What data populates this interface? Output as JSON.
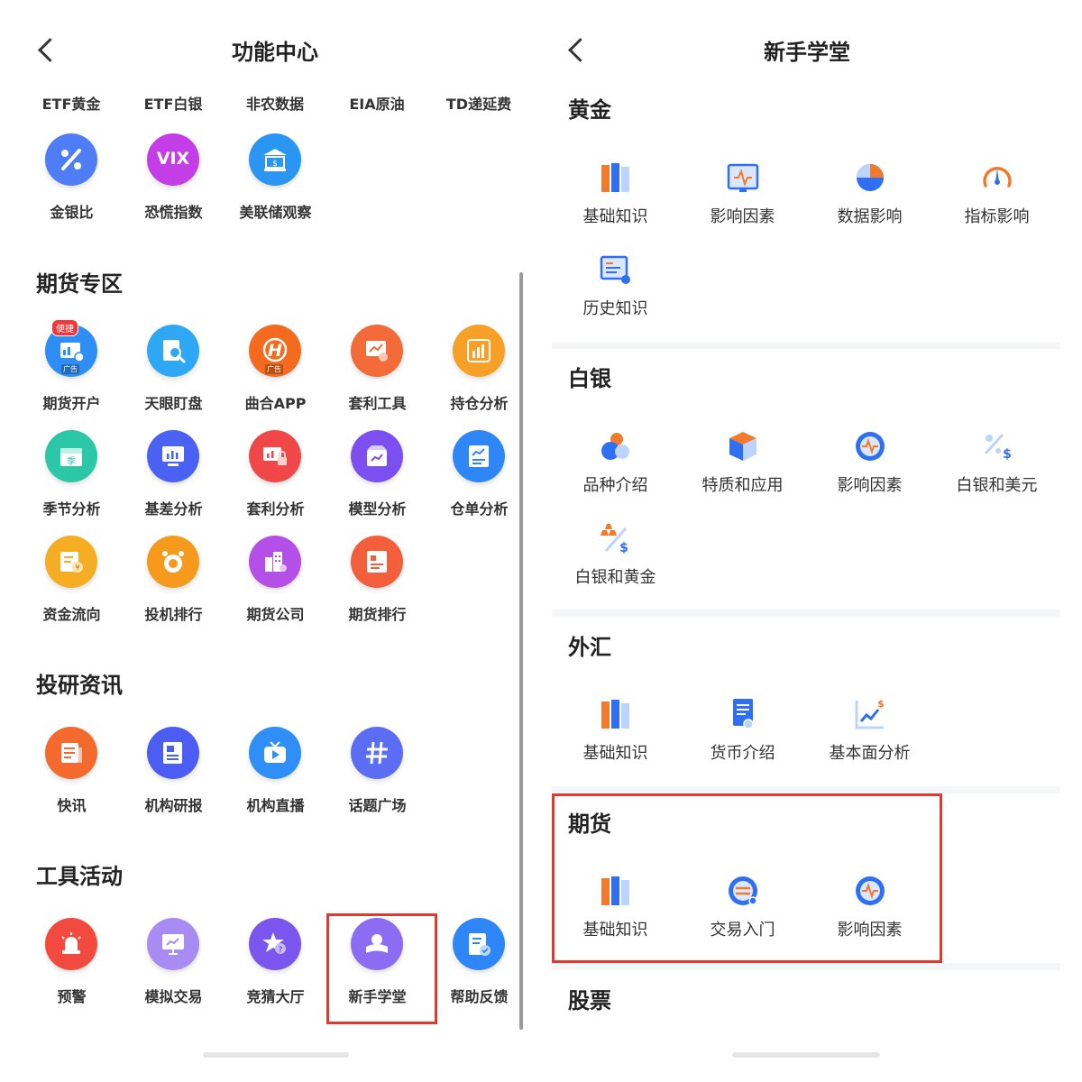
{
  "left": {
    "title": "功能中心",
    "top_tabs": [
      "ETF黄金",
      "ETF白银",
      "非农数据",
      "EIA原油",
      "TD递延费"
    ],
    "top_items": [
      {
        "label": "金银比",
        "icon": "percent-icon",
        "color": "#4f7df6"
      },
      {
        "label": "恐慌指数",
        "icon": "vix-icon",
        "text": "VIX",
        "color": "#c43ee8"
      },
      {
        "label": "美联储观察",
        "icon": "bank-icon",
        "color": "#2b95f4"
      }
    ],
    "sections": [
      {
        "title": "期货专区",
        "items": [
          {
            "label": "期货开户",
            "icon": "account-open-icon",
            "color": "#2e8ef6",
            "badge": "便捷",
            "ad": "广告"
          },
          {
            "label": "天眼盯盘",
            "icon": "search-doc-icon",
            "color": "#2ea8f5"
          },
          {
            "label": "曲合APP",
            "icon": "app-logo-icon",
            "color": "#f46b1f",
            "ad": "广告"
          },
          {
            "label": "套利工具",
            "icon": "arbitrage-tool-icon",
            "color": "#f26b38"
          },
          {
            "label": "持仓分析",
            "icon": "position-chart-icon",
            "color": "#f7a028"
          },
          {
            "label": "季节分析",
            "icon": "calendar-icon",
            "color": "#2cc7a6"
          },
          {
            "label": "基差分析",
            "icon": "monitor-chart-icon",
            "color": "#4a62f3"
          },
          {
            "label": "套利分析",
            "icon": "lock-chart-icon",
            "color": "#f04848"
          },
          {
            "label": "模型分析",
            "icon": "box-chart-icon",
            "color": "#7b4ff0"
          },
          {
            "label": "仓单分析",
            "icon": "warehouse-doc-icon",
            "color": "#2f86f6"
          },
          {
            "label": "资金流向",
            "icon": "money-flow-icon",
            "color": "#f5ad23"
          },
          {
            "label": "投机排行",
            "icon": "alarm-clock-icon",
            "color": "#f59a1d"
          },
          {
            "label": "期货公司",
            "icon": "building-icon",
            "color": "#b44fe8"
          },
          {
            "label": "期货排行",
            "icon": "ranking-list-icon",
            "color": "#f35e3b"
          }
        ]
      },
      {
        "title": "投研资讯",
        "items": [
          {
            "label": "快讯",
            "icon": "news-flash-icon",
            "color": "#f46a2e"
          },
          {
            "label": "机构研报",
            "icon": "report-icon",
            "color": "#4b5df2"
          },
          {
            "label": "机构直播",
            "icon": "tv-play-icon",
            "color": "#2f8ff6"
          },
          {
            "label": "话题广场",
            "icon": "hashtag-icon",
            "color": "#5b6ef3"
          }
        ]
      },
      {
        "title": "工具活动",
        "items": [
          {
            "label": "预警",
            "icon": "siren-icon",
            "color": "#f24a3e"
          },
          {
            "label": "模拟交易",
            "icon": "presentation-icon",
            "color": "#a98cf3"
          },
          {
            "label": "竞猜大厅",
            "icon": "star-question-icon",
            "color": "#7a55ee"
          },
          {
            "label": "新手学堂",
            "icon": "graduation-icon",
            "color": "#8c6cf2"
          },
          {
            "label": "帮助反馈",
            "icon": "feedback-doc-icon",
            "color": "#2f86f6"
          }
        ]
      }
    ]
  },
  "right": {
    "title": "新手学堂",
    "sections": [
      {
        "title": "黄金",
        "items": [
          {
            "label": "基础知识",
            "icon": "books-icon"
          },
          {
            "label": "影响因素",
            "icon": "pulse-book-icon"
          },
          {
            "label": "数据影响",
            "icon": "pie-icon"
          },
          {
            "label": "指标影响",
            "icon": "gauge-icon"
          },
          {
            "label": "历史知识",
            "icon": "history-doc-icon"
          }
        ]
      },
      {
        "title": "白银",
        "items": [
          {
            "label": "品种介绍",
            "icon": "bubbles-icon"
          },
          {
            "label": "特质和应用",
            "icon": "cube-icon"
          },
          {
            "label": "影响因素",
            "icon": "pulse-circle-icon"
          },
          {
            "label": "白银和美元",
            "icon": "silver-dollar-icon"
          },
          {
            "label": "白银和黄金",
            "icon": "silver-gold-icon"
          }
        ]
      },
      {
        "title": "外汇",
        "items": [
          {
            "label": "基础知识",
            "icon": "books-icon"
          },
          {
            "label": "货币介绍",
            "icon": "currency-doc-icon"
          },
          {
            "label": "基本面分析",
            "icon": "trend-dollar-icon"
          }
        ]
      },
      {
        "title": "期货",
        "items": [
          {
            "label": "基础知识",
            "icon": "books-icon"
          },
          {
            "label": "交易入门",
            "icon": "exchange-circle-icon"
          },
          {
            "label": "影响因素",
            "icon": "pulse-circle-icon"
          }
        ]
      },
      {
        "title": "股票",
        "items": []
      }
    ]
  }
}
